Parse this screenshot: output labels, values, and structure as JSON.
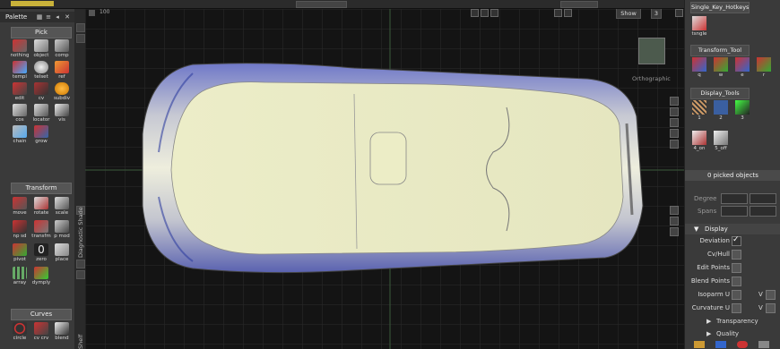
{
  "viewport_top": {
    "zoom_label": "100",
    "show_label": "Show",
    "view_number": "3"
  },
  "viewport": {
    "view_name": "Orthographic"
  },
  "palette": {
    "title": "Palette",
    "sections": {
      "pick": "Pick",
      "transform": "Transform",
      "curves": "Curves"
    },
    "pick_tools": [
      "nothing",
      "object",
      "comp",
      "templ",
      "telset",
      "ref",
      "edit",
      "cv",
      "subdiv",
      "cos",
      "locator",
      "vis",
      "chain",
      "grow"
    ],
    "transform_tools": [
      "move",
      "rotate",
      "scale",
      "np sd",
      "transfm",
      "p mod",
      "pivot",
      "zero",
      "place",
      "array",
      "dymply"
    ],
    "curve_tools": [
      "circle",
      "cv crv",
      "blend"
    ]
  },
  "side_strip": {
    "diagnostic": "Diagnostic Shade",
    "shelf": "Shelf"
  },
  "right_panel": {
    "hotkeys_title": "Single_Key_Hotkeys",
    "hotkeys_tool": "tsngle",
    "transform_tool_title": "Transform_Tool",
    "transform_tool_labels": [
      "q",
      "w",
      "e",
      "r"
    ],
    "display_tools_title": "Display_Tools",
    "display_tool_labels": [
      "1",
      "2",
      "3",
      "4_on",
      "5_off"
    ],
    "picked": "0 picked objects",
    "degree_label": "Degree",
    "spans_label": "Spans",
    "display_header": "Display",
    "display_rows": [
      {
        "label": "Deviation",
        "checked": true
      },
      {
        "label": "Cv/Hull",
        "checked": false
      },
      {
        "label": "Edit Points",
        "checked": false
      },
      {
        "label": "Blend Points",
        "checked": false
      },
      {
        "label": "Isoparm U",
        "checked": false,
        "v": "V"
      },
      {
        "label": "Curvature U",
        "checked": false,
        "v": "V"
      }
    ],
    "transparency": "Transparency",
    "quality": "Quality"
  }
}
